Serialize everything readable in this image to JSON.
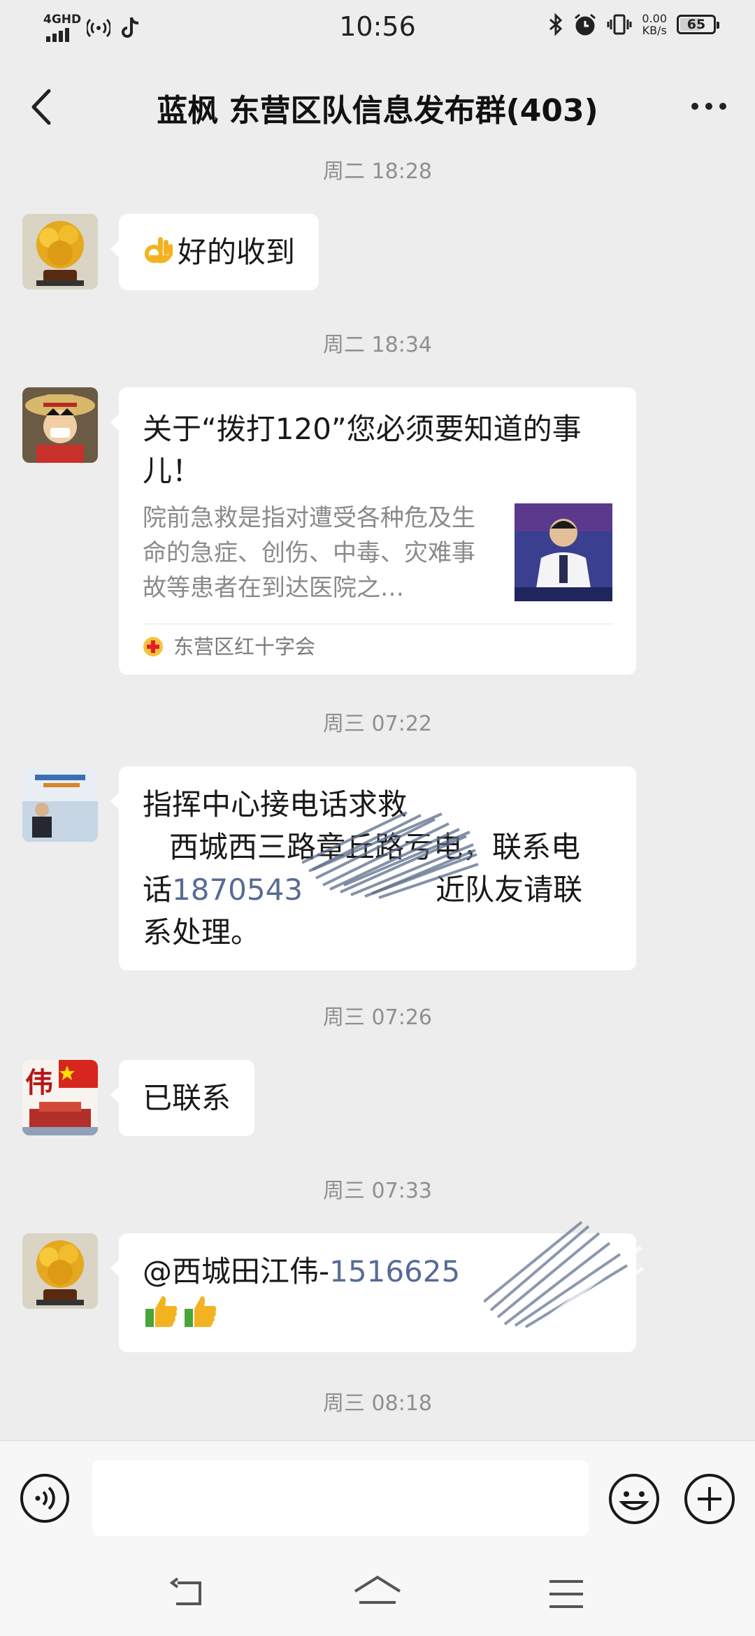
{
  "status_bar": {
    "network": "4GHD",
    "time": "10:56",
    "net_speed_value": "0.00",
    "net_speed_unit": "KB/s",
    "battery": "65"
  },
  "nav": {
    "title": "蓝枫 东营区队信息发布群(403)"
  },
  "messages": [
    {
      "timestamp": "周二 18:28",
      "text": "好的收到",
      "emoji": "ok-hand"
    },
    {
      "timestamp": "周二 18:34",
      "card": {
        "title": "关于“拨打120”您必须要知道的事儿！",
        "description": "院前急救是指对遭受各种危及生命的急症、创伤、中毒、灾难事故等患者在到达医院之…",
        "source": "东营区红十字会"
      }
    },
    {
      "timestamp": "周三 07:22",
      "line1": "指挥中心接电话求救",
      "line2": "西城西三路章丘路亏电，联系电",
      "line3_prefix": "话",
      "line3_number": "1870543",
      "line3_suffix": "近队友请联",
      "line4": "系处理。"
    },
    {
      "timestamp": "周三 07:26",
      "text": "已联系"
    },
    {
      "timestamp": "周三 07:33",
      "mention": "@西城田江伟-",
      "number": "1516625"
    },
    {
      "timestamp": "周三 08:18"
    }
  ]
}
